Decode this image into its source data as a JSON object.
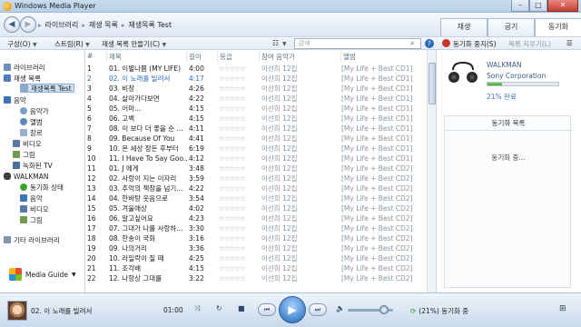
{
  "window": {
    "title": "Windows Media Player",
    "min": "–",
    "max": "□",
    "close": "✕"
  },
  "nav": {
    "breadcrumb": [
      "라이브러리",
      "재생 목록",
      "재생목록 Test"
    ],
    "tabs": [
      {
        "label": "재생",
        "active": false
      },
      {
        "label": "굽기",
        "active": false
      },
      {
        "label": "동기화",
        "active": true
      }
    ]
  },
  "toolbar": {
    "organize": "구성(O)",
    "stream": "스트림(R)",
    "create_playlist": "재생 목록 만들기(C)",
    "search_placeholder": "검색",
    "stop_sync": "동기화 중지(S)",
    "sync_options": "목록 지우기(L)"
  },
  "leftnav": {
    "items": [
      {
        "label": "라이브러리",
        "icon": "library-icon",
        "level": 0
      },
      {
        "label": "재생 목록",
        "icon": "playlist-icon",
        "level": 0
      },
      {
        "label": "재생목록 Test",
        "icon": "playlist-item-icon",
        "level": 1,
        "selected": true
      },
      {
        "label": "음악",
        "icon": "music-icon",
        "level": 0
      },
      {
        "label": "음악가",
        "icon": "artist-icon",
        "level": 1
      },
      {
        "label": "앨범",
        "icon": "album-icon",
        "level": 1
      },
      {
        "label": "장르",
        "icon": "genre-icon",
        "level": 1
      },
      {
        "label": "비디오",
        "icon": "video-icon",
        "level": 0
      },
      {
        "label": "그림",
        "icon": "picture-icon",
        "level": 0
      },
      {
        "label": "녹화된 TV",
        "icon": "tv-icon",
        "level": 0
      },
      {
        "label": "WALKMAN",
        "icon": "device-icon",
        "level": 0
      },
      {
        "label": "동기화 상태",
        "icon": "sync-status-icon",
        "level": 1
      },
      {
        "label": "음악",
        "icon": "music-icon",
        "level": 1
      },
      {
        "label": "비디오",
        "icon": "video-icon",
        "level": 1
      },
      {
        "label": "그림",
        "icon": "picture-icon",
        "level": 1
      },
      {
        "label": "기타 라이브러리",
        "icon": "other-library-icon",
        "level": 0
      }
    ],
    "media_guide": "Media Guide"
  },
  "list": {
    "columns": [
      "#",
      "제목",
      "길이",
      "등급",
      "참여 음악가",
      "앨범"
    ],
    "rating_glyph": "☆☆☆☆☆",
    "rows": [
      {
        "num": "1",
        "title": "01. 이별나쁨 (MY LIFE)",
        "length": "4:00",
        "artist": "이선희 12집",
        "album": "[My Life + Best CD1]"
      },
      {
        "num": "2",
        "title": "02. 이 노래를 빌려서",
        "length": "4:17",
        "artist": "이선희 12집",
        "album": "[My Life + Best CD1]",
        "playing": true
      },
      {
        "num": "3",
        "title": "03. 비창",
        "length": "4:26",
        "artist": "이선희 12집",
        "album": "[My Life + Best CD1]"
      },
      {
        "num": "4",
        "title": "04. 살아가다보면",
        "length": "4:22",
        "artist": "이선희 12집",
        "album": "[My Life + Best CD1]"
      },
      {
        "num": "5",
        "title": "05. 어마...",
        "length": "4:15",
        "artist": "이선희 12집",
        "album": "[My Life + Best CD1]"
      },
      {
        "num": "6",
        "title": "06. 고백",
        "length": "4:15",
        "artist": "이선희 12집",
        "album": "[My Life + Best CD1]"
      },
      {
        "num": "7",
        "title": "08. 이 보다 더 좋을 순 ...",
        "length": "4:11",
        "artist": "이선희 12집",
        "album": "[My Life + Best CD1]"
      },
      {
        "num": "8",
        "title": "09. Because Of You",
        "length": "4:41",
        "artist": "이선희 12집",
        "album": "[My Life + Best CD1]"
      },
      {
        "num": "9",
        "title": "10. 온 세상 장든 후부터",
        "length": "6:19",
        "artist": "이선희 12집",
        "album": "[My Life + Best CD1]"
      },
      {
        "num": "10",
        "title": "11. I Have To Say Goo...",
        "length": "4:12",
        "artist": "이선희 12집",
        "album": "[My Life + Best CD1]"
      },
      {
        "num": "11",
        "title": "01. J 에게",
        "length": "3:48",
        "artist": "이선희 12집",
        "album": "[My Life + Best CD2]"
      },
      {
        "num": "12",
        "title": "02. 사랑이 지는 이자리",
        "length": "3:59",
        "artist": "이선희 12집",
        "album": "[My Life + Best CD2]"
      },
      {
        "num": "13",
        "title": "03. 추억의 책장을 넘기...",
        "length": "4:22",
        "artist": "이선희 12집",
        "album": "[My Life + Best CD2]"
      },
      {
        "num": "14",
        "title": "04. 한바탕 웃음으로",
        "length": "3:54",
        "artist": "이선희 12집",
        "album": "[My Life + Best CD2]"
      },
      {
        "num": "15",
        "title": "05. 겨울애상",
        "length": "4:02",
        "artist": "이선희 12집",
        "album": "[My Life + Best CD2]"
      },
      {
        "num": "16",
        "title": "06. 알고싶어요",
        "length": "4:23",
        "artist": "이선희 12집",
        "album": "[My Life + Best CD2]"
      },
      {
        "num": "17",
        "title": "07. 그대가 나를 사랑하...",
        "length": "3:30",
        "artist": "이선희 12집",
        "album": "[My Life + Best CD2]"
      },
      {
        "num": "18",
        "title": "08. 한송이 국화",
        "length": "3:16",
        "artist": "이선희 12집",
        "album": "[My Life + Best CD2]"
      },
      {
        "num": "19",
        "title": "09. 나의거리",
        "length": "3:36",
        "artist": "이선희 12집",
        "album": "[My Life + Best CD2]"
      },
      {
        "num": "20",
        "title": "10. 라일락이 질 때",
        "length": "4:25",
        "artist": "이선희 12집",
        "album": "[My Life + Best CD2]"
      },
      {
        "num": "21",
        "title": "11. 조각배",
        "length": "4:15",
        "artist": "이선희 12집",
        "album": "[My Life + Best CD2]"
      },
      {
        "num": "22",
        "title": "12. 나항상 그대를",
        "length": "3:22",
        "artist": "이선희 12집",
        "album": "[My Life + Best CD2]"
      }
    ]
  },
  "device": {
    "name": "WALKMAN",
    "vendor": "Sony Corporation",
    "progress_percent": 21,
    "progress_label": "21% 완료",
    "sync_list_title": "동기화 목록",
    "sync_status": "동기화 중..."
  },
  "player": {
    "now_playing": "02. 이 노래를 빌려서",
    "time": "01:00",
    "volume_percent": 80,
    "sync_text": "(21%) 동기화 중",
    "colors": {
      "accent": "#1f63b8",
      "progress": "#3da42a",
      "stop": "#c7352b"
    }
  }
}
